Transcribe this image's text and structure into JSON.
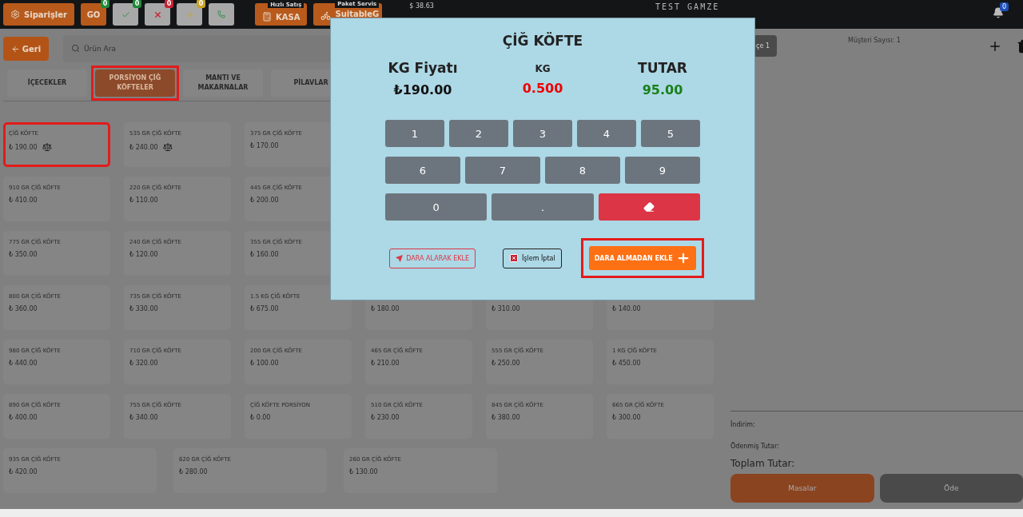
{
  "topbar": {
    "orders_button": "Siparişler",
    "status_buttons": [
      {
        "kind": "go",
        "label": "GO",
        "badge": "0",
        "color": "#1f8a3a"
      },
      {
        "kind": "check",
        "badge": "0",
        "color": "#1f8a3a"
      },
      {
        "kind": "cross",
        "badge": "0",
        "color": "#c82333"
      },
      {
        "kind": "arrow",
        "badge": "0",
        "color": "#c9a227"
      },
      {
        "kind": "phone"
      }
    ],
    "quick_sale": {
      "tag": "Hızlı Satış",
      "label": "KASA"
    },
    "delivery": {
      "tag": "Paket Servis",
      "label": "SuitableG"
    },
    "balance": "$ 38.63",
    "title": "TEST GAMZE",
    "notification_badge": "0"
  },
  "back_button": "Geri",
  "search": {
    "placeholder": "Ürün Ara"
  },
  "categories": [
    {
      "label": "İÇECEKLER",
      "selected": false,
      "highlighted": false
    },
    {
      "label": "PORSİYON ÇİĞ KÖFTELER",
      "selected": true,
      "highlighted": true
    },
    {
      "label": "MANTI VE MAKARNALAR",
      "selected": false,
      "highlighted": false
    },
    {
      "label": "PİLAVLAR",
      "selected": false,
      "highlighted": false
    }
  ],
  "product_rows": [
    [
      {
        "name": "ÇİĞ KÖFTE",
        "price": "₺ 190.00",
        "weighed": true,
        "highlighted": true
      },
      {
        "name": "535 GR ÇİĞ KÖFTE",
        "price": "₺ 240.00",
        "weighed": true,
        "highlighted": false
      },
      {
        "name": "375 GR ÇİĞ KÖFTE",
        "price": "₺ 170.00",
        "weighed": false,
        "highlighted": false
      }
    ],
    [
      {
        "name": "910 GR ÇİĞ KÖFTE",
        "price": "₺ 410.00",
        "weighed": false,
        "highlighted": false
      },
      {
        "name": "220 GR ÇİĞ KÖFTE",
        "price": "₺ 110.00",
        "weighed": false,
        "highlighted": false
      },
      {
        "name": "445 GR ÇİĞ KÖFTE",
        "price": "₺ 200.00",
        "weighed": false,
        "highlighted": false
      }
    ],
    [
      {
        "name": "775 GR ÇİĞ KÖFTE",
        "price": "₺ 350.00",
        "weighed": false,
        "highlighted": false
      },
      {
        "name": "240 GR ÇİĞ KÖFTE",
        "price": "₺ 120.00",
        "weighed": false,
        "highlighted": false
      },
      {
        "name": "355 GR ÇİĞ KÖFTE",
        "price": "₺ 160.00",
        "weighed": false,
        "highlighted": false
      }
    ],
    [
      {
        "name": "800 GR ÇİĞ KÖFTE",
        "price": "₺ 360.00",
        "weighed": false,
        "highlighted": false
      },
      {
        "name": "735 GR ÇİĞ KÖFTE",
        "price": "₺ 330.00",
        "weighed": false,
        "highlighted": false
      },
      {
        "name": "1.5 KG ÇİĞ KÖFTE",
        "price": "₺ 675.00",
        "weighed": false,
        "highlighted": false
      },
      {
        "price": "₺ 180.00",
        "weighed": false,
        "highlighted": false
      },
      {
        "price": "₺ 310.00",
        "weighed": false,
        "highlighted": false
      },
      {
        "price": "₺ 140.00",
        "weighed": false,
        "highlighted": false
      }
    ],
    [
      {
        "name": "980 GR ÇİĞ KÖFTE",
        "price": "₺ 440.00",
        "weighed": false,
        "highlighted": false
      },
      {
        "name": "710 GR ÇİĞ KÖFTE",
        "price": "₺ 320.00",
        "weighed": false,
        "highlighted": false
      },
      {
        "name": "200 GR ÇİĞ KÖFTE",
        "price": "₺ 100.00",
        "weighed": false,
        "highlighted": false
      },
      {
        "name": "465 GR ÇİĞ KÖFTE",
        "price": "₺ 210.00",
        "weighed": false,
        "highlighted": false
      },
      {
        "name": "555 GR ÇİĞ KÖFTE",
        "price": "₺ 250.00",
        "weighed": false,
        "highlighted": false
      },
      {
        "name": "1 KG ÇİĞ KÖFTE",
        "price": "₺ 450.00",
        "weighed": false,
        "highlighted": false
      }
    ],
    [
      {
        "name": "890 GR ÇİĞ KÖFTE",
        "price": "₺ 400.00",
        "weighed": false,
        "highlighted": false
      },
      {
        "name": "755 GR ÇİĞ KÖFTE",
        "price": "₺ 340.00",
        "weighed": false,
        "highlighted": false
      },
      {
        "name": "ÇİĞ KÖFTE PORSİYON",
        "price": "₺ 0.00",
        "weighed": false,
        "highlighted": false
      },
      {
        "name": "510 GR ÇİĞ KÖFTE",
        "price": "₺ 230.00",
        "weighed": false,
        "highlighted": false
      },
      {
        "name": "845 GR ÇİĞ KÖFTE",
        "price": "₺ 380.00",
        "weighed": false,
        "highlighted": false
      },
      {
        "name": "665 GR ÇİĞ KÖFTE",
        "price": "₺ 300.00",
        "weighed": false,
        "highlighted": false
      }
    ],
    [
      {
        "name": "935 GR ÇİĞ KÖFTE",
        "price": "₺ 420.00",
        "weighed": false,
        "highlighted": false
      },
      {
        "name": "620 GR ÇİĞ KÖFTE",
        "price": "₺ 280.00",
        "weighed": false,
        "highlighted": false
      },
      {
        "name": "260 GR ÇİĞ KÖFTE",
        "price": "₺ 130.00",
        "weighed": false,
        "highlighted": false
      }
    ]
  ],
  "order_panel": {
    "tab": "çe 1",
    "customer_count": "Müşteri Sayısı: 1",
    "discount": "İndirim:",
    "paid": "Ödenmiş Tutar:",
    "total": "Toplam Tutar:",
    "tables_button": "Masalar",
    "pay_button": "Öde"
  },
  "dialog": {
    "title": "ÇİĞ KÖFTE",
    "fields": [
      {
        "kind": "price",
        "label": "KG Fiyatı",
        "value": "₺190.00"
      },
      {
        "kind": "weight",
        "label": "KG",
        "value": "0.500"
      },
      {
        "kind": "total",
        "label": "TUTAR",
        "value": "95.00"
      }
    ],
    "keypad": [
      [
        {
          "kind": "digit",
          "label": "1"
        },
        {
          "kind": "digit",
          "label": "2"
        },
        {
          "kind": "digit",
          "label": "3"
        },
        {
          "kind": "digit",
          "label": "4"
        },
        {
          "kind": "digit",
          "label": "5"
        }
      ],
      [
        {
          "kind": "digit",
          "label": "6"
        },
        {
          "kind": "digit",
          "label": "7"
        },
        {
          "kind": "digit",
          "label": "8"
        },
        {
          "kind": "digit",
          "label": "9"
        }
      ],
      [
        {
          "kind": "digit",
          "label": "0"
        },
        {
          "kind": "digit",
          "label": "."
        },
        {
          "kind": "erase"
        }
      ]
    ],
    "actions": [
      {
        "kind": "tare",
        "label": "DARA ALARAK EKLE",
        "highlighted": false
      },
      {
        "kind": "cancel",
        "label": "İşlem İptal",
        "highlighted": false
      },
      {
        "kind": "add",
        "label": "DARA ALMADAN EKLE",
        "highlighted": true
      }
    ]
  }
}
